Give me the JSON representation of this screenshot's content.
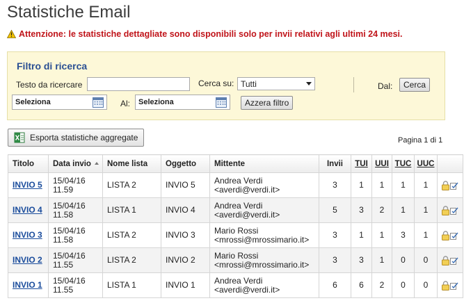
{
  "page": {
    "title": "Statistiche Email",
    "warning": "Attenzione: le statistiche dettagliate sono disponibili solo per invii relativi agli ultimi 24 mesi."
  },
  "filter": {
    "title": "Filtro di ricerca",
    "search_label": "Testo da ricercare",
    "search_value": "",
    "search_in_label": "Cerca su:",
    "search_in_value": "Tutti",
    "from_label": "Dal:",
    "from_value": "Seleziona",
    "to_label": "Al:",
    "to_value": "Seleziona",
    "search_button": "Cerca",
    "reset_button": "Azzera filtro"
  },
  "toolbar": {
    "export_label": "Esporta statistiche aggregate",
    "pager": "Pagina 1 di 1"
  },
  "table": {
    "headers": {
      "titolo": "Titolo",
      "data_invio": "Data invio",
      "nome_lista": "Nome lista",
      "oggetto": "Oggetto",
      "mittente": "Mittente",
      "invii": "Invii",
      "tui": "TUI",
      "uui": "UUI",
      "tuc": "TUC",
      "uuc": "UUC"
    },
    "rows": [
      {
        "titolo": "INVIO 5",
        "data": "15/04/16",
        "ora": "11.59",
        "lista": "LISTA 2",
        "oggetto": "INVIO 5",
        "mittente_nome": "Andrea Verdi",
        "mittente_email": "<averdi@verdi.it>",
        "invii": "3",
        "tui": "1",
        "uui": "1",
        "tuc": "1",
        "uuc": "1"
      },
      {
        "titolo": "INVIO 4",
        "data": "15/04/16",
        "ora": "11.58",
        "lista": "LISTA 1",
        "oggetto": "INVIO 4",
        "mittente_nome": "Andrea Verdi",
        "mittente_email": "<averdi@verdi.it>",
        "invii": "5",
        "tui": "3",
        "uui": "2",
        "tuc": "1",
        "uuc": "1"
      },
      {
        "titolo": "INVIO 3",
        "data": "15/04/16",
        "ora": "11.58",
        "lista": "LISTA 2",
        "oggetto": "INVIO 3",
        "mittente_nome": "Mario Rossi",
        "mittente_email": "<mrossi@mrossimario.it>",
        "invii": "3",
        "tui": "1",
        "uui": "1",
        "tuc": "3",
        "uuc": "1"
      },
      {
        "titolo": "INVIO 2",
        "data": "15/04/16",
        "ora": "11.55",
        "lista": "LISTA 2",
        "oggetto": "INVIO 2",
        "mittente_nome": "Mario Rossi",
        "mittente_email": "<mrossi@mrossimario.it>",
        "invii": "3",
        "tui": "3",
        "uui": "1",
        "tuc": "0",
        "uuc": "0"
      },
      {
        "titolo": "INVIO 1",
        "data": "15/04/16",
        "ora": "11.55",
        "lista": "LISTA 1",
        "oggetto": "INVIO 1",
        "mittente_nome": "Andrea Verdi",
        "mittente_email": "<averdi@verdi.it>",
        "invii": "6",
        "tui": "6",
        "uui": "2",
        "tuc": "0",
        "uuc": "0"
      }
    ]
  },
  "icons": {
    "warning": "warning-icon",
    "calendar": "calendar-icon",
    "excel": "excel-icon",
    "lock": "lock-icon",
    "edit": "edit-icon"
  },
  "colors": {
    "warning_text": "#c0141a",
    "filter_background": "#fdf8d8",
    "filter_title": "#2a4f93",
    "link": "#1a4c9c"
  }
}
